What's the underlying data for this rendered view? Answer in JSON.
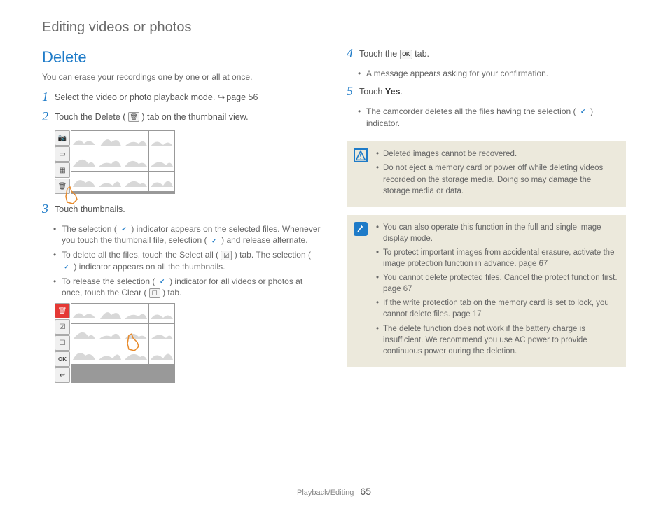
{
  "page": {
    "section_title": "Editing videos or photos",
    "heading": "Delete",
    "intro": "You can erase your recordings one by one or all at once.",
    "footer_section": "Playback/Editing",
    "footer_page": "65"
  },
  "steps": {
    "s1": {
      "num": "1",
      "text": "Select the video or photo playback mode. ",
      "ref": "page 56"
    },
    "s2": {
      "num": "2",
      "text_a": "Touch the Delete ( ",
      "text_b": " ) tab on the thumbnail view."
    },
    "s3": {
      "num": "3",
      "text": "Touch thumbnails.",
      "b1a": "The selection ( ",
      "b1b": " ) indicator appears on the selected files. Whenever you touch the thumbnail file, selection ( ",
      "b1c": " ) and release alternate.",
      "b2a": "To delete all the files, touch the Select all ( ",
      "b2b": " ) tab. The selection ( ",
      "b2c": " ) indicator appears on all the thumbnails.",
      "b3a": "To release the selection ( ",
      "b3b": " ) indicator for all videos or photos at once, touch the Clear ( ",
      "b3c": " ) tab."
    },
    "s4": {
      "num": "4",
      "text_a": "Touch the ",
      "text_b": " tab.",
      "b1": "A message appears asking for your confirmation."
    },
    "s5": {
      "num": "5",
      "text_a": "Touch ",
      "yes": "Yes",
      "text_b": ".",
      "b1a": "The camcorder deletes all the files having the selection ( ",
      "b1b": " ) indicator."
    }
  },
  "warn": {
    "b1": "Deleted images cannot be recovered.",
    "b2": "Do not eject a memory card or power off while deleting videos recorded on the storage media. Doing so may damage the storage media or data."
  },
  "info": {
    "b1": "You can also operate this function in the full and single image display mode.",
    "b2a": "To protect important images from accidental erasure, activate the image protection function in advance. ",
    "b2ref": "page 67",
    "b3a": "You cannot delete protected files. Cancel the protect function first. ",
    "b3ref": "page 67",
    "b4a": "If the write protection tab on the memory card is set to lock, you cannot delete files. ",
    "b4ref": "page 17",
    "b5": "The delete function does not work if the battery charge is insufficient. We recommend you use AC power to provide continuous power during the deletion."
  },
  "icons": {
    "trash": "🗑",
    "check": "✓",
    "selectall": "�ella",
    "clear": "▭",
    "ok": "OK",
    "back": "↩",
    "camera": "📷",
    "film": "▦"
  }
}
